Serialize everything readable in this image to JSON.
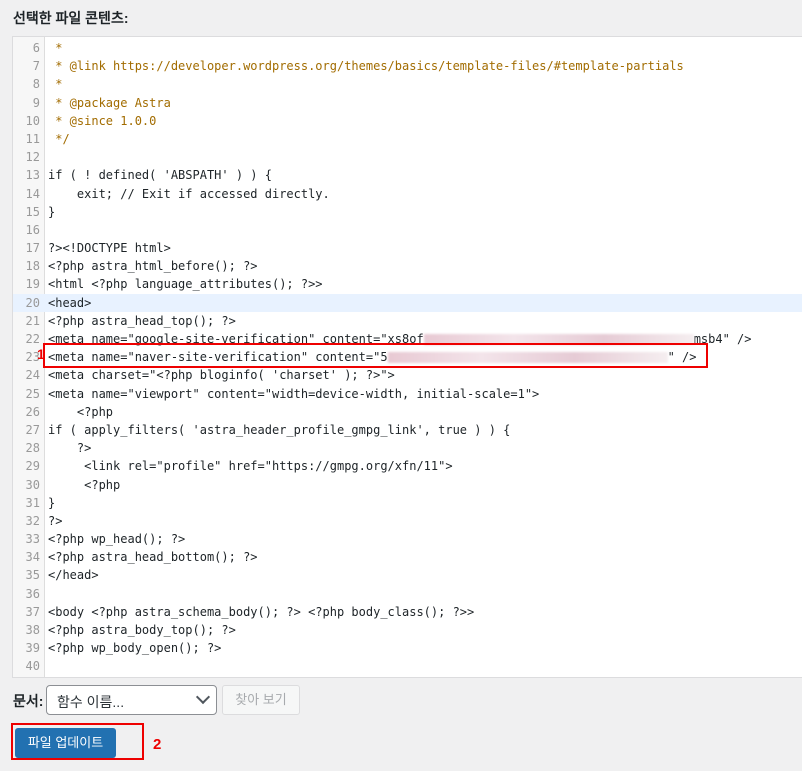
{
  "heading": "선택한 파일 콘텐츠:",
  "editor": {
    "lines": [
      {
        "n": "6",
        "t": " *"
      },
      {
        "n": "7",
        "t": " * @link https://developer.wordpress.org/themes/basics/template-files/#template-partials"
      },
      {
        "n": "8",
        "t": " *"
      },
      {
        "n": "9",
        "t": " * @package Astra"
      },
      {
        "n": "10",
        "t": " * @since 1.0.0"
      },
      {
        "n": "11",
        "t": " */"
      },
      {
        "n": "12",
        "t": ""
      },
      {
        "n": "13",
        "t": "if ( ! defined( 'ABSPATH' ) ) {"
      },
      {
        "n": "14",
        "t": "    exit; // Exit if accessed directly."
      },
      {
        "n": "15",
        "t": "}"
      },
      {
        "n": "16",
        "t": ""
      },
      {
        "n": "17",
        "t": "?><!DOCTYPE html>"
      },
      {
        "n": "18",
        "t": "<?php astra_html_before(); ?>"
      },
      {
        "n": "19",
        "t": "<html <?php language_attributes(); ?>>"
      },
      {
        "n": "20",
        "t": "<head>"
      },
      {
        "n": "21",
        "t": "<?php astra_head_top(); ?>"
      },
      {
        "n": "22",
        "t_a": "<meta name=\"google-site-verification\" content=\"xs8of",
        "t_b": "msb4\" />"
      },
      {
        "n": "23",
        "t_a": "<meta name=\"naver-site-verification\" content=\"5",
        "t_b": "\" />"
      },
      {
        "n": "24",
        "t": "<meta charset=\"<?php bloginfo( 'charset' ); ?>\">"
      },
      {
        "n": "25",
        "t": "<meta name=\"viewport\" content=\"width=device-width, initial-scale=1\">"
      },
      {
        "n": "26",
        "t": "    <?php"
      },
      {
        "n": "27",
        "t": "if ( apply_filters( 'astra_header_profile_gmpg_link', true ) ) {"
      },
      {
        "n": "28",
        "t": "    ?>"
      },
      {
        "n": "29",
        "t": "     <link rel=\"profile\" href=\"https://gmpg.org/xfn/11\">"
      },
      {
        "n": "30",
        "t": "     <?php"
      },
      {
        "n": "31",
        "t": "}"
      },
      {
        "n": "32",
        "t": "?>"
      },
      {
        "n": "33",
        "t": "<?php wp_head(); ?>"
      },
      {
        "n": "34",
        "t": "<?php astra_head_bottom(); ?>"
      },
      {
        "n": "35",
        "t": "</head>"
      },
      {
        "n": "36",
        "t": ""
      },
      {
        "n": "37",
        "t": "<body <?php astra_schema_body(); ?> <?php body_class(); ?>>"
      },
      {
        "n": "38",
        "t": "<?php astra_body_top(); ?>"
      },
      {
        "n": "39",
        "t": "<?php wp_body_open(); ?>"
      },
      {
        "n": "40",
        "t": ""
      }
    ]
  },
  "annotations": {
    "mark_one": "1",
    "mark_two": "2"
  },
  "document": {
    "label": "문서:",
    "select_value": "함수 이름...",
    "lookup_label": "찾아 보기"
  },
  "update_button_label": "파일 업데이트",
  "colors": {
    "primary": "#2271b1",
    "annotation_red": "#e00000"
  }
}
